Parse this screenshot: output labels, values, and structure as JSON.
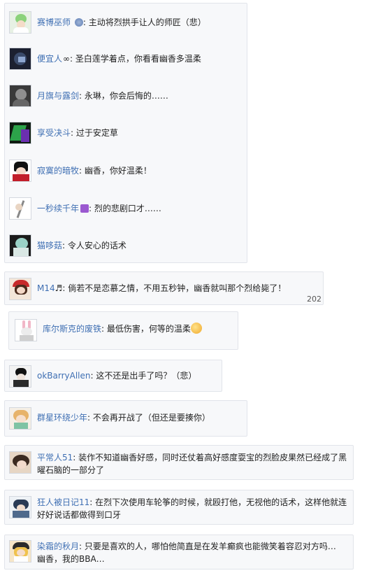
{
  "comments": [
    {
      "user": "赛博巫师",
      "sep": ": ",
      "text": "主动将烈拱手让人的师匠（悲）",
      "badge": "globe-badge-icon"
    },
    {
      "user": "便宜人",
      "sep": ": ",
      "text": "圣白莲学着点，你看看幽香多温柔",
      "badge": "infinity-badge-icon"
    },
    {
      "user": "月旗与露剑",
      "sep": ": ",
      "text": "永琳，你会后悔的……"
    },
    {
      "user": "享受决斗",
      "sep": ": ",
      "text": "过于安定草"
    },
    {
      "user": "寂寞的暗牧",
      "sep": ": ",
      "text": "幽香，你好温柔！"
    },
    {
      "user": "一秒续千年",
      "sep": ": ",
      "text": "烈的悲剧口才……",
      "badge": "purple-badge-icon"
    },
    {
      "user": "猫哆菇",
      "sep": ": ",
      "text": "令人安心的话术"
    }
  ],
  "cards": [
    {
      "user": "M14",
      "sep": ": ",
      "text": "倘若不是恋慕之情，不用五秒钟，幽香就叫那个烈给毙了！",
      "timestamp": "202",
      "note_icon": "music-note-icon"
    },
    {
      "user": "库尔斯克的废铁",
      "sep": ": ",
      "text": "最低伤害，何等的温柔"
    },
    {
      "user": "okBarryAllen",
      "sep": ": ",
      "text": "这不还是出手了吗？（悲）"
    },
    {
      "user": "群星环绕少年",
      "sep": ": ",
      "text": "不会再开战了（但还是要揍你）"
    },
    {
      "user": "平常人51",
      "sep": ": ",
      "text": "装作不知道幽香好感，同时还仗着高好感度耍宝的烈脸皮果然已经成了黑曜石脑的一部分了"
    },
    {
      "user": "狂人被日记11",
      "sep": ": ",
      "text": "在烈下次使用车轮筝的时候，就殴打他，无视他的话术，这样他就连好好说话都做得到口牙"
    },
    {
      "user": "染霜的秋月",
      "sep": ": ",
      "text": "只要是喜欢的人，哪怕他简直是在发羊癫疯也能微笑着容忍对方吗…",
      "text2": "幽香，我的BBA…"
    }
  ],
  "colors": {
    "username": "#3f6fb3",
    "card_bg": "#f7f8fa",
    "border": "#e1e4ea"
  }
}
